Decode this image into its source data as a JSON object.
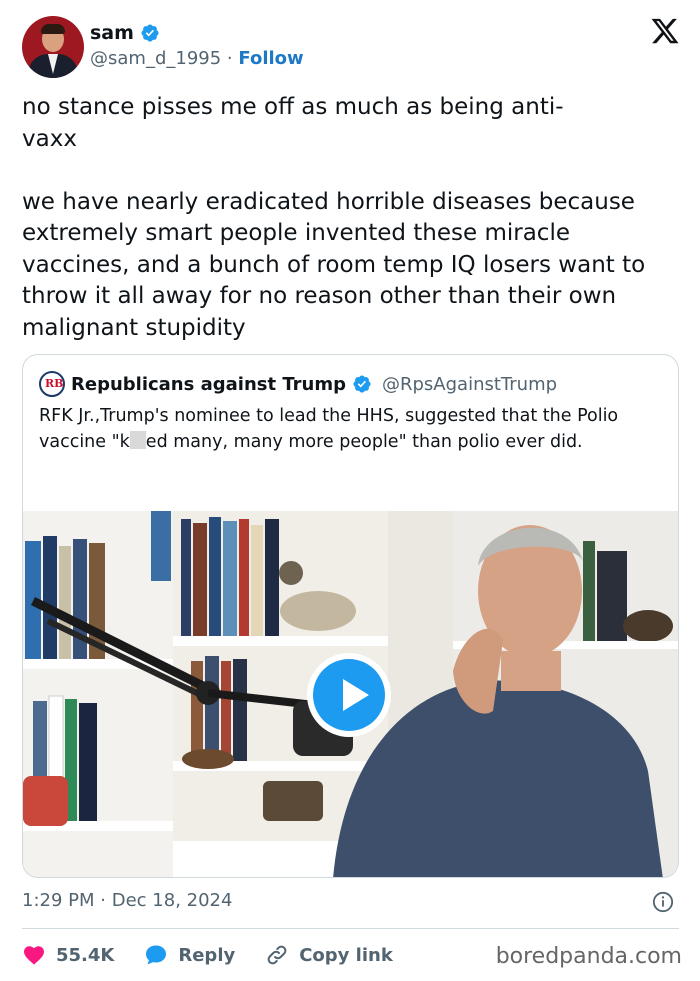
{
  "author": {
    "name": "sam",
    "handle": "@sam_d_1995",
    "separator": "·",
    "follow_label": "Follow",
    "verified_color": "#1d9bf0"
  },
  "icons": {
    "platform": "x-logo-icon",
    "verified": "verified-badge-icon",
    "like": "heart-icon",
    "reply": "speech-bubble-icon",
    "copy": "link-icon",
    "info": "info-icon",
    "play": "play-icon"
  },
  "tweet": {
    "text": "no stance pisses me off as much as being anti-\nvaxx\n\nwe have nearly eradicated horrible diseases because extremely smart people invented these miracle vaccines, and a bunch of room temp IQ losers want to throw it all away for no reason other than their own malignant stupidity"
  },
  "quote": {
    "name": "Republicans against Trump",
    "handle": "@RpsAgainstTrump",
    "logo_text": "RB",
    "text_before": "RFK Jr.,Trump's nominee to lead the HHS, suggested that the Polio vaccine \"k",
    "text_after": "ed many, many more people\" than polio ever did."
  },
  "meta": {
    "time": "1:29 PM",
    "separator": "·",
    "date": "Dec 18, 2024"
  },
  "actions": {
    "likes": "55.4K",
    "reply_label": "Reply",
    "copy_label": "Copy link"
  },
  "watermark": "boredpanda.com",
  "colors": {
    "like": "#f91880",
    "accent": "#1d9bf0",
    "link_blue": "#1d79c6"
  }
}
